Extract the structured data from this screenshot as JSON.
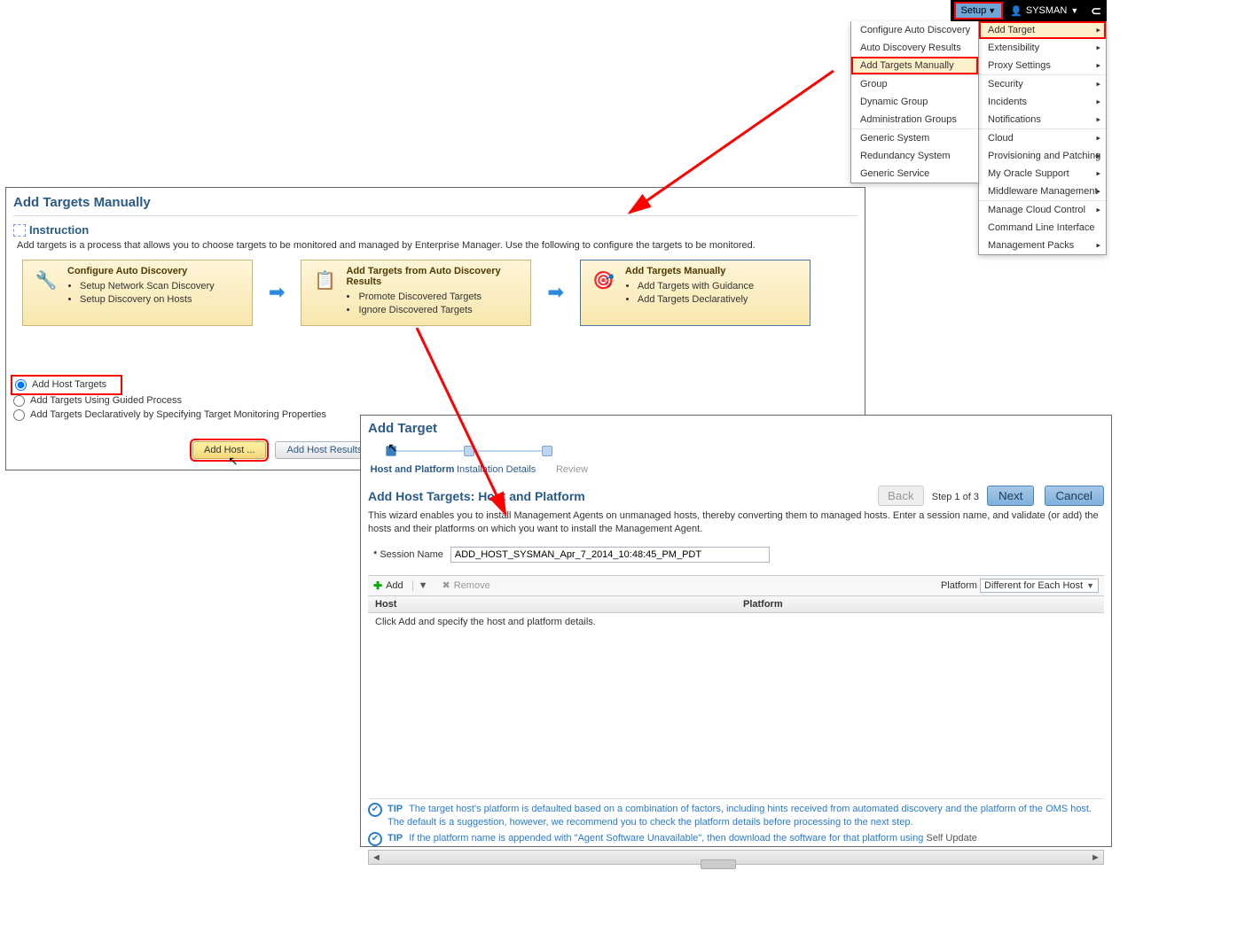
{
  "topbar": {
    "setup_label": "Setup",
    "user_label": "SYSMAN"
  },
  "setup_menu": [
    {
      "label": "Add Target",
      "arrow": true,
      "highlight": true,
      "redbox": true
    },
    {
      "label": "Extensibility",
      "arrow": true
    },
    {
      "label": "Proxy Settings",
      "arrow": true
    },
    {
      "label": "Security",
      "arrow": true,
      "sep": true
    },
    {
      "label": "Incidents",
      "arrow": true
    },
    {
      "label": "Notifications",
      "arrow": true
    },
    {
      "label": "Cloud",
      "arrow": true,
      "sep": true
    },
    {
      "label": "Provisioning and Patching",
      "arrow": true
    },
    {
      "label": "My Oracle Support",
      "arrow": true
    },
    {
      "label": "Middleware Management",
      "arrow": true
    },
    {
      "label": "Manage Cloud Control",
      "arrow": true,
      "sep": true
    },
    {
      "label": "Command Line Interface"
    },
    {
      "label": "Management Packs",
      "arrow": true
    }
  ],
  "addtarget_menu": [
    {
      "label": "Configure Auto Discovery"
    },
    {
      "label": "Auto Discovery Results"
    },
    {
      "label": "Add Targets Manually",
      "highlight": true,
      "redbox": true
    },
    {
      "label": "Group",
      "sep": true
    },
    {
      "label": "Dynamic Group"
    },
    {
      "label": "Administration Groups"
    },
    {
      "label": "Generic System",
      "sep": true
    },
    {
      "label": "Redundancy System"
    },
    {
      "label": "Generic Service"
    }
  ],
  "panel1": {
    "title": "Add Targets Manually",
    "instruction_title": "Instruction",
    "instruction_text": "Add targets is a process that allows you to choose targets to be monitored and managed by Enterprise Manager. Use the following to configure the targets to be monitored.",
    "card1": {
      "title": "Configure Auto Discovery",
      "items": [
        "Setup Network Scan Discovery",
        "Setup Discovery on Hosts"
      ]
    },
    "card2": {
      "title": "Add Targets from Auto Discovery Results",
      "items": [
        "Promote Discovered Targets",
        "Ignore Discovered Targets"
      ]
    },
    "card3": {
      "title": "Add Targets Manually",
      "items": [
        "Add Targets with Guidance",
        "Add Targets Declaratively"
      ]
    },
    "radios": [
      "Add Host Targets",
      "Add Targets Using Guided Process",
      "Add Targets Declaratively by Specifying Target Monitoring Properties"
    ],
    "add_host_btn": "Add Host ...",
    "add_host_results_btn": "Add Host Results"
  },
  "panel2": {
    "title": "Add Target",
    "train": [
      "Host and Platform",
      "Installation Details",
      "Review"
    ],
    "subtitle": "Add Host Targets: Host and Platform",
    "back": "Back",
    "step": "Step 1 of 3",
    "next": "Next",
    "cancel": "Cancel",
    "wizard_text": "This wizard enables you to install Management Agents on unmanaged hosts, thereby converting them to managed hosts. Enter a session name, and validate (or add) the hosts and their platforms on which you want to install the Management Agent.",
    "session_name_label": "Session Name",
    "session_name_value": "ADD_HOST_SYSMAN_Apr_7_2014_10:48:45_PM_PDT",
    "toolbar": {
      "add": "Add",
      "remove": "Remove",
      "platform_label": "Platform",
      "platform_value": "Different for Each Host"
    },
    "grid": {
      "col1": "Host",
      "col2": "Platform",
      "empty": "Click Add and specify the host and platform details."
    },
    "tip1": "The target host's platform is defaulted based on a combination of factors, including hints received from automated discovery and the platform of the OMS host. The default is a suggestion, however, we recommend you to check the platform details before processing to the next step.",
    "tip2_pre": "If the platform name is appended with \"Agent Software Unavailable\", then download the software for that platform using ",
    "tip2_link": "Self Update",
    "tip_label": "TIP"
  }
}
